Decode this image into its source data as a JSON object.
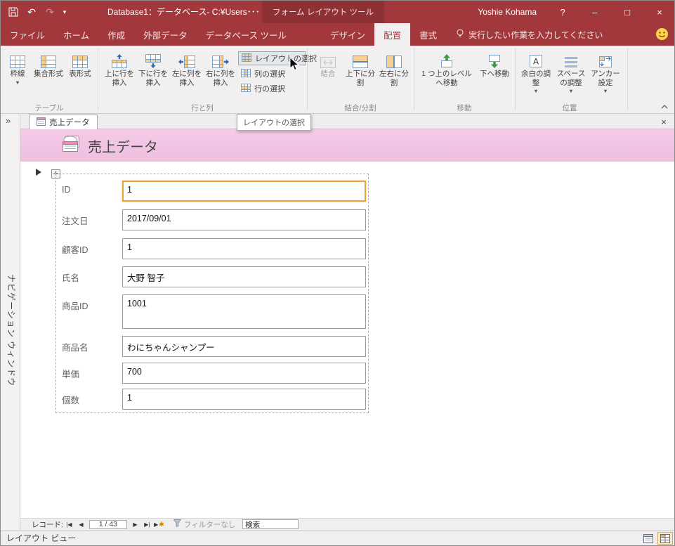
{
  "colors": {
    "accent": "#A3383C",
    "header_pink": "#F2C4E3",
    "selection_orange": "#E8A33D"
  },
  "titlebar": {
    "title": "Database1：データベース- C:¥Users･･･",
    "contextual": "フォーム レイアウト ツール",
    "user": "Yoshie Kohama",
    "help": "?",
    "minimize": "–",
    "maximize": "□",
    "close": "×"
  },
  "ribbon": {
    "tabs": [
      "ファイル",
      "ホーム",
      "作成",
      "外部データ",
      "データベース ツール",
      "デザイン",
      "配置",
      "書式"
    ],
    "active_tab": "配置",
    "search_hint": "実行したい作業を入力してください",
    "groups": [
      {
        "label": "テーブル",
        "buttons": [
          "枠線",
          "集合形式",
          "表形式"
        ]
      },
      {
        "label": "行と列",
        "buttons": [
          "上に行を挿入",
          "下に行を挿入",
          "左に列を挿入",
          "右に列を挿入"
        ],
        "small": [
          "レイアウトの選択",
          "列の選択",
          "行の選択"
        ]
      },
      {
        "label": "結合/分割",
        "buttons": [
          "結合",
          "上下に分割",
          "左右に分割"
        ]
      },
      {
        "label": "移動",
        "buttons": [
          "1 つ上のレベルへ移動",
          "下へ移動"
        ]
      },
      {
        "label": "位置",
        "buttons": [
          "余白の調整",
          "スペースの調整",
          "アンカー設定"
        ]
      }
    ]
  },
  "tooltip": "レイアウトの選択",
  "tabbar": {
    "tab": "売上データ",
    "close": "×"
  },
  "navpane": {
    "label": "ナビゲーション ウィンドウ",
    "expand": "»"
  },
  "form": {
    "title": "売上データ",
    "fields": [
      {
        "label": "ID",
        "value": "1",
        "selected": true
      },
      {
        "label": "注文日",
        "value": "2017/09/01"
      },
      {
        "label": "顧客ID",
        "value": "1"
      },
      {
        "label": "氏名",
        "value": "大野 智子"
      },
      {
        "label": "商品ID",
        "value": "1001",
        "tall": true
      },
      {
        "label": "商品名",
        "value": "わにちゃんシャンプー"
      },
      {
        "label": "単価",
        "value": "700"
      },
      {
        "label": "個数",
        "value": "1"
      }
    ]
  },
  "recordnav": {
    "label": "レコード:",
    "position": "1 / 43",
    "filter": "フィルターなし",
    "search": "検索"
  },
  "statusbar": {
    "view": "レイアウト ビュー"
  }
}
